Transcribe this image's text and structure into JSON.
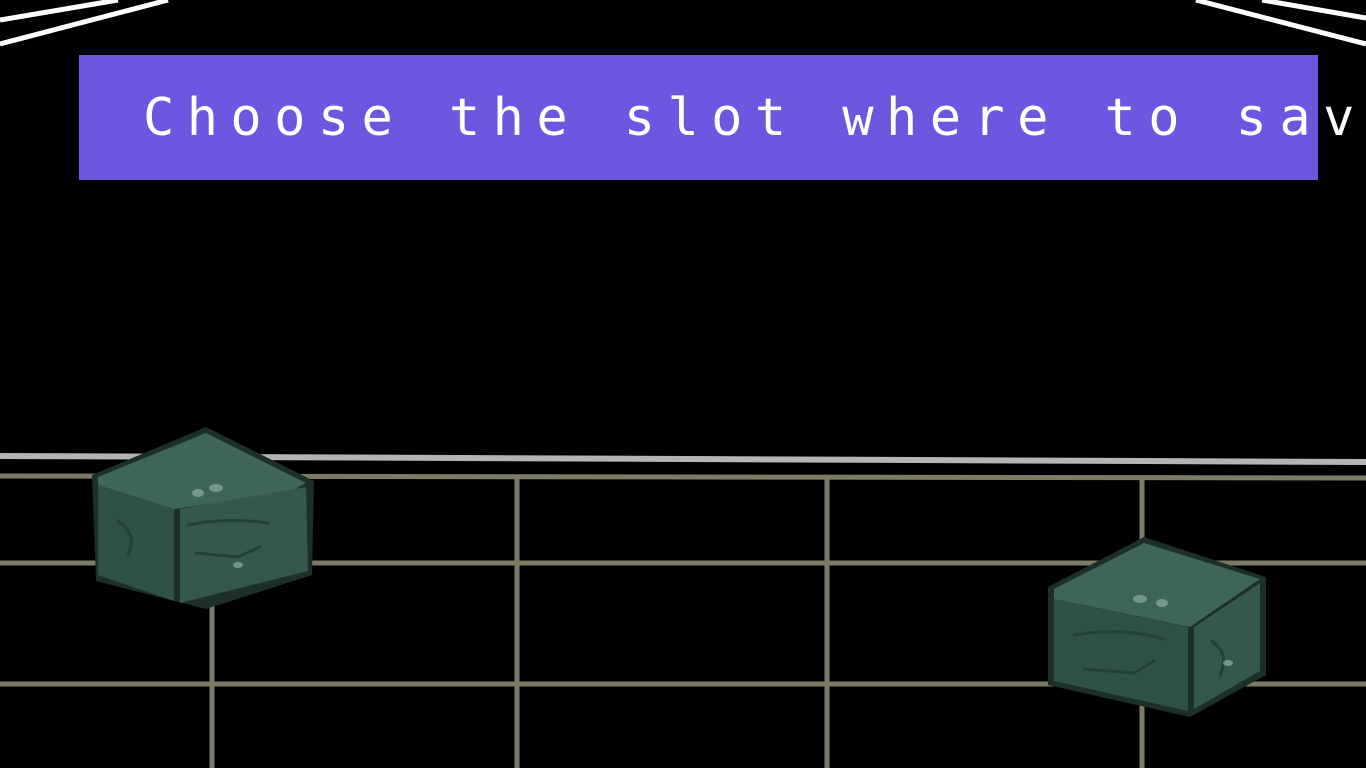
{
  "banner": {
    "title": "Choose the slot where to save"
  },
  "colors": {
    "background": "#000000",
    "banner": "#6b57e0",
    "banner_text": "#ffffff",
    "grid_line": "#7c7c64",
    "floor_edge": "#b4b4b4",
    "frame_line": "#ffffff",
    "stone_top": "#3d6658",
    "stone_side": "#2e5246",
    "stone_outline": "#1c3029"
  },
  "save_slots": [
    {
      "name": "save-block-1",
      "icon": "stone-block-icon"
    },
    {
      "name": "save-block-2",
      "icon": "stone-block-icon"
    }
  ]
}
